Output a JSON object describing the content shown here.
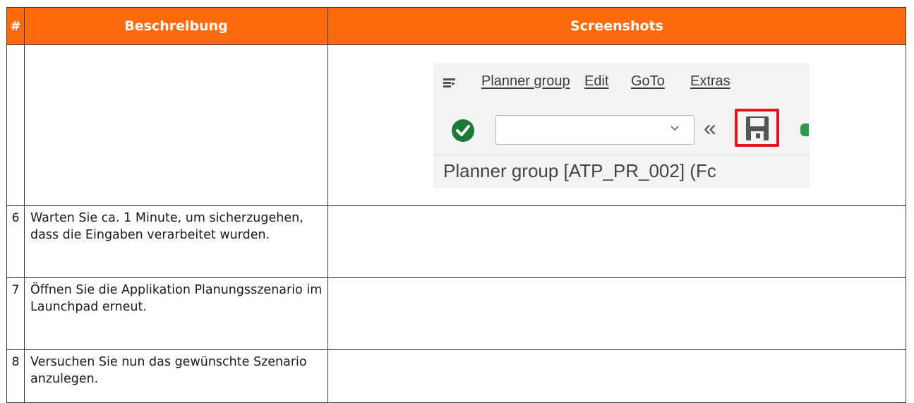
{
  "table": {
    "headers": {
      "num": "#",
      "description": "Beschreibung",
      "screenshots": "Screenshots"
    },
    "rows": [
      {
        "num": "6",
        "description": "Warten Sie ca. 1 Minute, um sicherzugehen, dass die Eingaben verarbeitet wurden."
      },
      {
        "num": "7",
        "description": "Öffnen Sie die Applikation Planungsszenario im Launchpad erneut."
      },
      {
        "num": "8",
        "description": "Versuchen Sie nun das gewünschte Szenario anzulegen."
      }
    ]
  },
  "screenshot": {
    "menu": [
      "Planner group",
      "Edit",
      "GoTo",
      "Extras"
    ],
    "combo_value": "",
    "icons": [
      "menu-icon",
      "check-icon",
      "chevron-down-icon",
      "double-chevron-left-icon",
      "save-icon"
    ],
    "highlight_color": "#e1161b",
    "title": "Planner group [ATP_PR_002] (Fc"
  },
  "colors": {
    "header_bg": "#ff6a0d",
    "header_text": "#ffffff",
    "check_green": "#1d7a36"
  }
}
